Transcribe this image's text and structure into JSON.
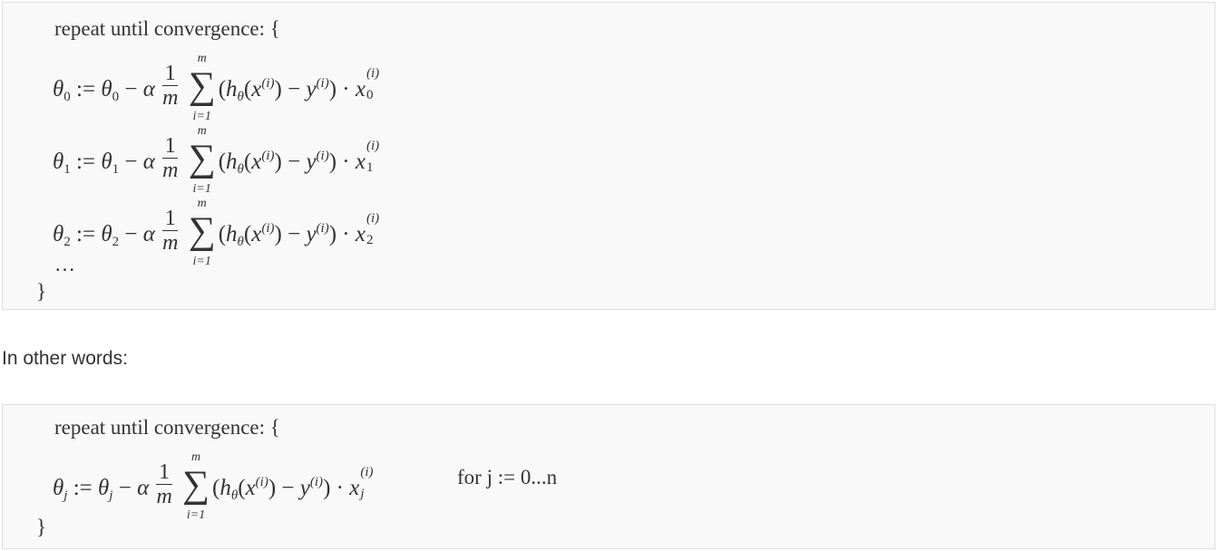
{
  "block1": {
    "header": "repeat until convergence: {",
    "rows": [
      {
        "idx": "0",
        "alpha": "α",
        "one": "1",
        "m": "m",
        "sum_upper": "m",
        "sum_lower": "i=1",
        "h_sub": "θ",
        "sup_i": "(i)",
        "x_sub": "0"
      },
      {
        "idx": "1",
        "alpha": "α",
        "one": "1",
        "m": "m",
        "sum_upper": "m",
        "sum_lower": "i=1",
        "h_sub": "θ",
        "sup_i": "(i)",
        "x_sub": "1"
      },
      {
        "idx": "2",
        "alpha": "α",
        "one": "1",
        "m": "m",
        "sum_upper": "m",
        "sum_lower": "i=1",
        "h_sub": "θ",
        "sup_i": "(i)",
        "x_sub": "2"
      }
    ],
    "ellipsis": "…",
    "close": "}"
  },
  "prose": "In other words:",
  "block2": {
    "header": "repeat until convergence: {",
    "row": {
      "idx": "j",
      "alpha": "α",
      "one": "1",
      "m": "m",
      "sum_upper": "m",
      "sum_lower": "i=1",
      "h_sub": "θ",
      "sup_i": "(i)",
      "x_sub": "j"
    },
    "for_text": "for j := 0...n",
    "close": "}"
  }
}
